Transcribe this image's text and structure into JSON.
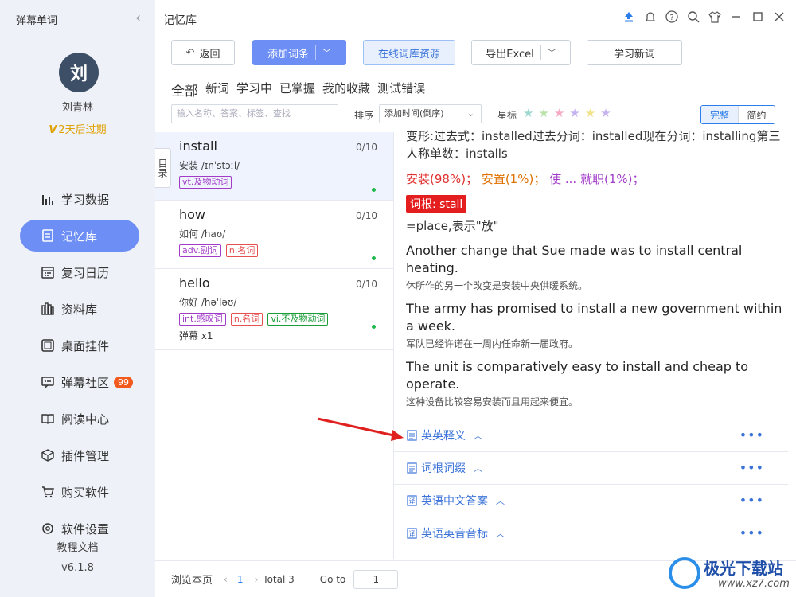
{
  "app": {
    "title": "弹幕单词",
    "collapse_icon": "chevron-left-icon"
  },
  "user": {
    "avatar_char": "刘",
    "name": "刘青林",
    "expire": "2天后过期",
    "vip_mark": "V"
  },
  "nav": [
    {
      "label": "学习数据",
      "icon": "bar-chart-icon",
      "active": false
    },
    {
      "label": "记忆库",
      "icon": "document-icon",
      "active": true
    },
    {
      "label": "复习日历",
      "icon": "calendar-icon",
      "active": false
    },
    {
      "label": "资料库",
      "icon": "books-icon",
      "active": false
    },
    {
      "label": "桌面挂件",
      "icon": "widget-icon",
      "active": false
    },
    {
      "label": "弹幕社区",
      "icon": "chat-icon",
      "active": false,
      "badge": "99"
    },
    {
      "label": "阅读中心",
      "icon": "book-open-icon",
      "active": false
    },
    {
      "label": "插件管理",
      "icon": "cube-icon",
      "active": false
    },
    {
      "label": "购买软件",
      "icon": "cart-icon",
      "active": false
    },
    {
      "label": "软件设置",
      "icon": "gear-icon",
      "active": false
    }
  ],
  "sidebar_footer": {
    "docs": "教程文档",
    "version": "v6.1.8"
  },
  "page": {
    "title": "记忆库"
  },
  "toolbar": {
    "back": "返回",
    "add": "添加词条",
    "online": "在线词库资源",
    "export": "导出Excel",
    "learn": "学习新词"
  },
  "filters": [
    "全部",
    "新词",
    "学习中",
    "已掌握",
    "我的收藏",
    "测试错误"
  ],
  "search": {
    "placeholder": "输入名称、答案、标签、查找"
  },
  "sort": {
    "label": "排序",
    "value": "添加时间(倒序)"
  },
  "star": {
    "label": "星标",
    "colors": [
      "#9fd8d0",
      "#b9e3a8",
      "#f5a9c4",
      "#c5b4f0",
      "#f1e38a",
      "#c7b4ee"
    ]
  },
  "view_toggle": {
    "full": "完整",
    "brief": "简约"
  },
  "catalog": "目录",
  "words": [
    {
      "word": "install",
      "count": "0/10",
      "meaning": "安装  /ɪnˈstɔːl/",
      "tags": [
        {
          "text": "vt.及物动词",
          "color": "purple"
        }
      ],
      "extra": "",
      "selected": true
    },
    {
      "word": "how",
      "count": "0/10",
      "meaning": "如何  /haʊ/",
      "tags": [
        {
          "text": "adv.副词",
          "color": "purple"
        },
        {
          "text": "n.名词",
          "color": "red"
        }
      ],
      "extra": "",
      "selected": false
    },
    {
      "word": "hello",
      "count": "0/10",
      "meaning": "你好  /həˈləʊ/",
      "tags": [
        {
          "text": "int.感叹词",
          "color": "purple"
        },
        {
          "text": "n.名词",
          "color": "red"
        },
        {
          "text": "vi.不及物动词",
          "color": "green"
        }
      ],
      "extra": "弹幕 x1",
      "selected": false
    }
  ],
  "detail": {
    "inflect": "变形:过去式：installed过去分词：installed现在分词：installing第三人称单数：installs",
    "senses": [
      "安装(98%)；",
      "安置(1%)；",
      "使 ... 就职(1%)；"
    ],
    "root_tag": "词根: stall",
    "root_note": "=place,表示\"放\"",
    "examples": [
      {
        "en": "Another change that Sue made was to install central heating.",
        "cn": "休所作的另一个改变是安装中央供暖系统。"
      },
      {
        "en": "The army has promised to install a new government within a week.",
        "cn": "军队已经许诺在一周内任命新一届政府。"
      },
      {
        "en": "The unit is comparatively easy to install and cheap to operate.",
        "cn": "这种设备比较容易安装而且用起来便宜。"
      }
    ]
  },
  "sections": [
    {
      "label": "英英释义",
      "icon": "document-icon"
    },
    {
      "label": "词根词缀",
      "icon": "document-icon"
    },
    {
      "label": "英语中文答案",
      "icon": "translate-icon"
    },
    {
      "label": "英语英音音标",
      "icon": "translate-icon"
    }
  ],
  "pager": {
    "label": "浏览本页",
    "page": "1",
    "total": "Total 3",
    "goto_label": "Go to",
    "goto_value": "1"
  },
  "watermark": {
    "title": "极光下载站",
    "url": "www.xz7.com"
  }
}
